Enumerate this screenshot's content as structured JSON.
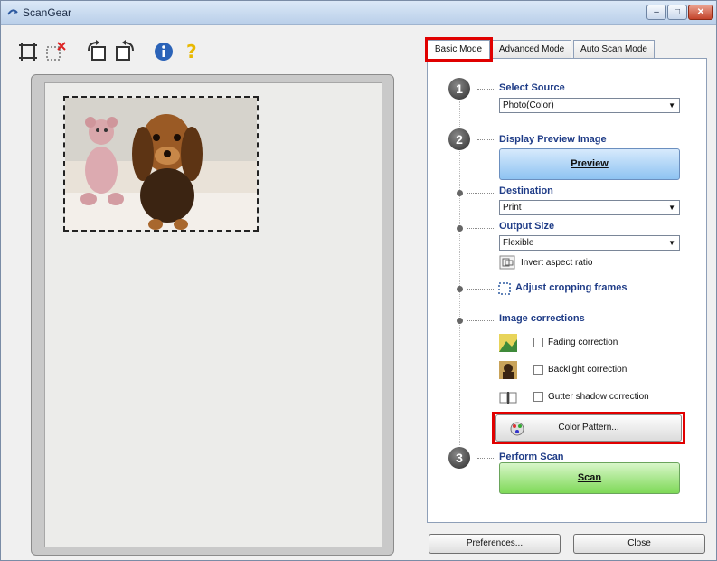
{
  "window": {
    "title": "ScanGear"
  },
  "tabs": [
    {
      "label": "Basic Mode",
      "active": true
    },
    {
      "label": "Advanced Mode",
      "active": false
    },
    {
      "label": "Auto Scan Mode",
      "active": false
    }
  ],
  "toolbar": {
    "icons": [
      "auto-crop-icon",
      "remove-crop-icon",
      "rotate-left-icon",
      "rotate-right-icon",
      "info-icon",
      "help-icon"
    ]
  },
  "steps": {
    "select_source": {
      "number": "1",
      "heading": "Select Source",
      "value": "Photo(Color)"
    },
    "display_preview": {
      "number": "2",
      "heading": "Display Preview Image",
      "button": "Preview"
    },
    "destination": {
      "heading": "Destination",
      "value": "Print"
    },
    "output_size": {
      "heading": "Output Size",
      "value": "Flexible",
      "invert_label": "Invert aspect ratio"
    },
    "adjust_cropping": {
      "label": "Adjust cropping frames"
    },
    "image_corrections": {
      "heading": "Image corrections",
      "items": [
        {
          "label": "Fading correction",
          "checked": false
        },
        {
          "label": "Backlight correction",
          "checked": false
        },
        {
          "label": "Gutter shadow correction",
          "checked": false
        }
      ],
      "color_pattern_button": "Color Pattern..."
    },
    "perform_scan": {
      "number": "3",
      "heading": "Perform Scan",
      "button": "Scan"
    }
  },
  "footer": {
    "preferences_button": "Preferences...",
    "close_button": "Close"
  },
  "colors": {
    "highlight": "#e00000",
    "heading": "#1f3c87",
    "preview_button": "#8ec3f2",
    "scan_button": "#7ed957"
  }
}
